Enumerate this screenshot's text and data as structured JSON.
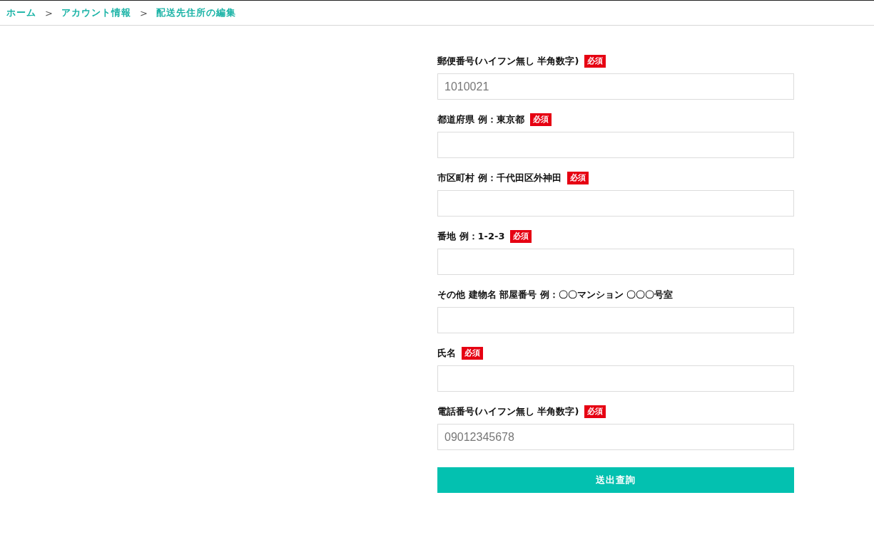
{
  "breadcrumb": [
    {
      "label": "ホーム",
      "kind": "link"
    },
    {
      "label": ">",
      "kind": "separator"
    },
    {
      "label": "アカウント情報",
      "kind": "link"
    },
    {
      "label": ">",
      "kind": "separator"
    },
    {
      "label": "配送先住所の編集",
      "kind": "link"
    }
  ],
  "form": {
    "fields": [
      {
        "label": "郵便番号(ハイフン無し 半角数字)",
        "required": true,
        "required_badge": "必須",
        "placeholder": "1010021"
      },
      {
        "label": "都道府県 例：東京都",
        "required": true,
        "required_badge": "必須"
      },
      {
        "label": "市区町村 例：千代田区外神田",
        "required": true,
        "required_badge": "必須"
      },
      {
        "label": "番地 例：1-2-3",
        "required": true,
        "required_badge": "必須"
      },
      {
        "label": "その他 建物名 部屋番号 例：〇〇マンション 〇〇〇号室",
        "required": false
      },
      {
        "label": "氏名",
        "required": true,
        "required_badge": "必須"
      },
      {
        "label": "電話番号(ハイフン無し 半角数字)",
        "required": true,
        "required_badge": "必須",
        "placeholder": "09012345678"
      }
    ],
    "submit": "送出查詢"
  }
}
